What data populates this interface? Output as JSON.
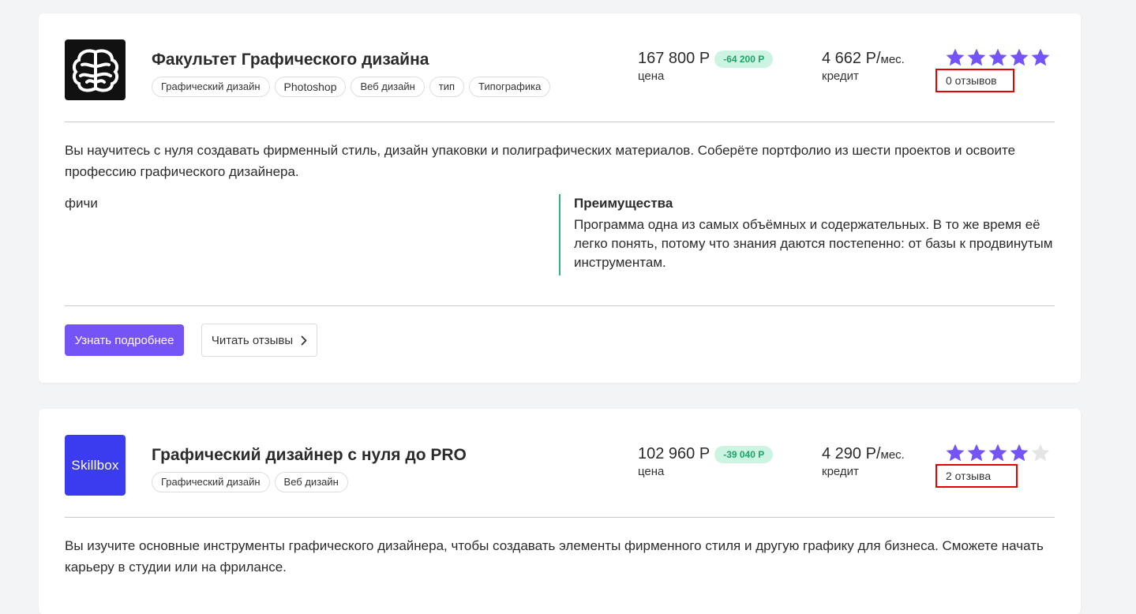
{
  "colors": {
    "accent": "#7554f7",
    "star_filled": "#7554f7",
    "star_empty": "#e5e5e5",
    "discount_bg": "#cdf3e2",
    "discount_text": "#1aa767",
    "highlight_border": "#e60000",
    "advantage_border": "#2fb37a"
  },
  "courses": [
    {
      "logo_icon": "brain-logo-icon",
      "title": "Факультет Графического дизайна",
      "tags": [
        "Графический дизайн",
        "Photoshop",
        "Веб дизайн",
        "тип",
        "Типографика"
      ],
      "price": "167 800 Р",
      "discount": "-64 200 Р",
      "price_caption": "цена",
      "credit": "4 662 Р/",
      "credit_unit": "мес.",
      "credit_caption": "кредит",
      "rating": 5,
      "reviews": "0 отзывов",
      "description": "Вы научитесь с нуля создавать фирменный стиль, дизайн упаковки и полиграфических материалов. Соберёте портфолио из шести проектов и освоите профессию графического дизайнера.",
      "features_label": "фичи",
      "advantages_title": "Преимущества",
      "advantages_text": "Программа одна из самых объёмных и содержательных. В то же время её легко понять, потому что знания даются постепенно: от базы к продвинутым инструментам.",
      "more_button": "Узнать подробнее",
      "reviews_button": "Читать отзывы"
    },
    {
      "logo_text": "Skillbox",
      "title": "Графический дизайнер с нуля до PRO",
      "tags": [
        "Графический дизайн",
        "Веб дизайн"
      ],
      "price": "102 960 Р",
      "discount": "-39 040 Р",
      "price_caption": "цена",
      "credit": "4 290 Р/",
      "credit_unit": "мес.",
      "credit_caption": "кредит",
      "rating": 4,
      "reviews": "2 отзыва",
      "description": "Вы изучите основные инструменты графического дизайнера, чтобы создавать элементы фирменного стиля и другую графику для бизнеса. Сможете начать карьеру в студии или на фрилансе."
    }
  ]
}
